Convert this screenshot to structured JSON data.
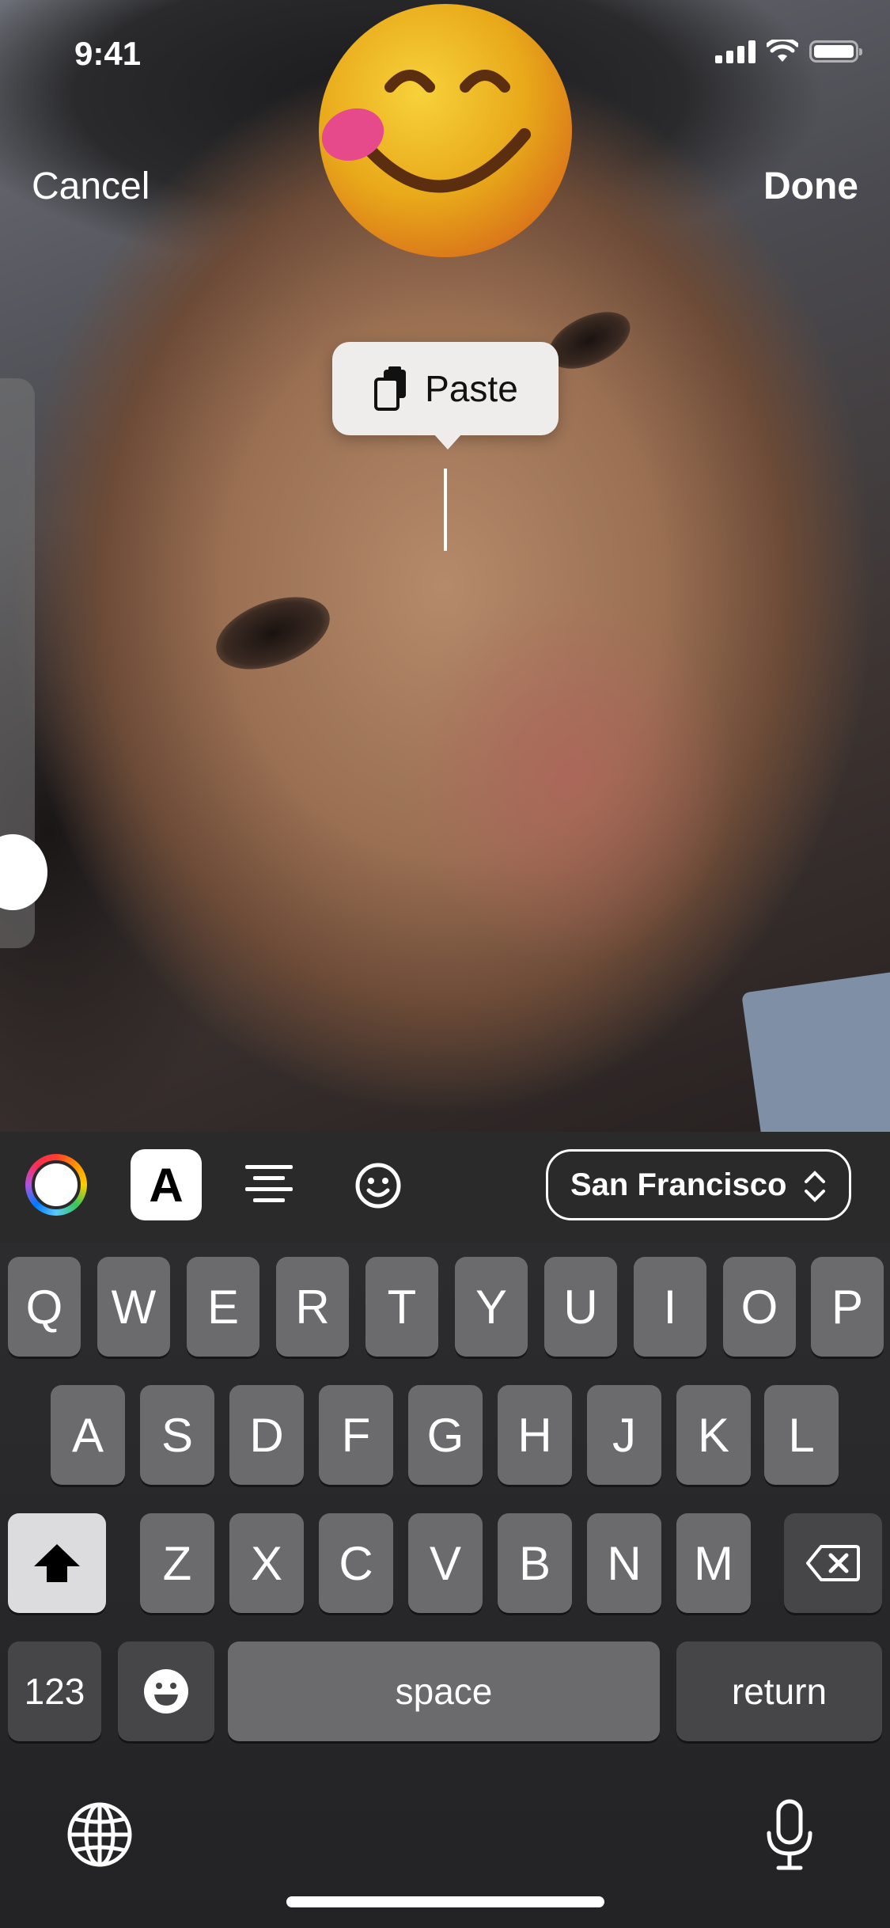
{
  "status_bar": {
    "time": "9:41"
  },
  "nav": {
    "cancel_label": "Cancel",
    "done_label": "Done"
  },
  "sticker": {
    "icon": "face-savoring-food-emoji"
  },
  "context_menu": {
    "paste_label": "Paste"
  },
  "toolbar": {
    "color_icon": "color-wheel-icon",
    "text_style_label": "A",
    "align_icon": "align-center-icon",
    "emoji_icon": "smiley-icon",
    "font_name": "San Francisco"
  },
  "keyboard": {
    "row1": [
      "Q",
      "W",
      "E",
      "R",
      "T",
      "Y",
      "U",
      "I",
      "O",
      "P"
    ],
    "row2": [
      "A",
      "S",
      "D",
      "F",
      "G",
      "H",
      "J",
      "K",
      "L"
    ],
    "row3": [
      "Z",
      "X",
      "C",
      "V",
      "B",
      "N",
      "M"
    ],
    "numbers_label": "123",
    "space_label": "space",
    "return_label": "return"
  }
}
